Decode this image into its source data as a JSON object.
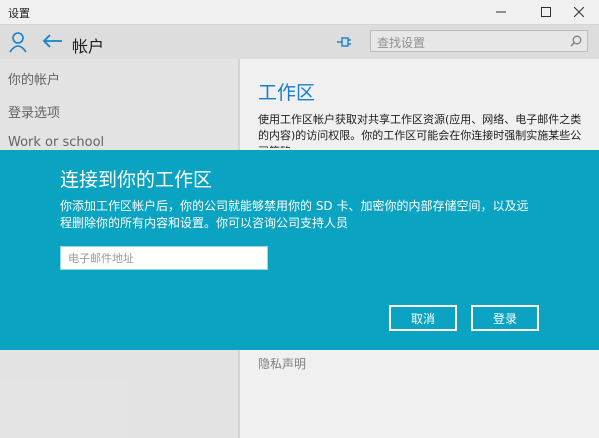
{
  "window": {
    "title": "设置"
  },
  "header": {
    "title": "帐户",
    "search_placeholder": "查找设置"
  },
  "sidebar": {
    "items": [
      {
        "label": "你的帐户"
      },
      {
        "label": "登录选项"
      },
      {
        "label": "Work or school"
      }
    ]
  },
  "content": {
    "title": "工作区",
    "description": "使用工作区帐户获取对共享工作区资源(应用、网络、电子邮件之类的内容)的访问权限。你的工作区可能会在你连接时强制实施某些公司策略。",
    "bottom_link": "隐私声明"
  },
  "dialog": {
    "title": "连接到你的工作区",
    "body": "你添加工作区帐户后，你的公司就能够禁用你的 SD 卡、加密你的内部存储空间，以及远程删除你的所有内容和设置。你可以咨询公司支持人员",
    "email_placeholder": "电子邮件地址",
    "cancel_label": "取消",
    "signin_label": "登录"
  },
  "colors": {
    "accent": "#1788d6",
    "dialog_bg": "#0aa3c2"
  }
}
